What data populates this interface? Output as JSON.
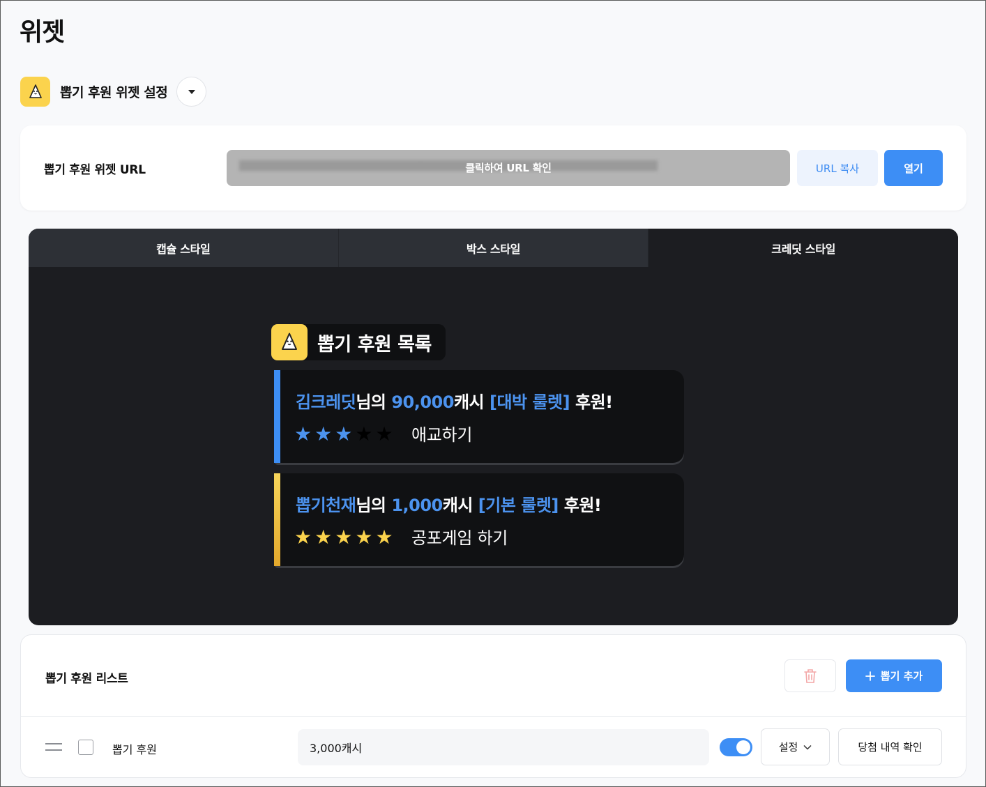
{
  "page": {
    "title": "위젯"
  },
  "selector": {
    "label": "뽑기 후원 위젯 설정",
    "icon": "mascot-icon",
    "dropdown_icon": "caret-down-icon"
  },
  "url_card": {
    "label": "뽑기 후원 위젯 URL",
    "url_overlay_text": "클릭하여 URL 확인",
    "copy_label": "URL 복사",
    "open_label": "열기"
  },
  "preview": {
    "tabs": [
      {
        "label": "캡슐 스타일",
        "active": false
      },
      {
        "label": "박스 스타일",
        "active": false
      },
      {
        "label": "크레딧 스타일",
        "active": true
      }
    ],
    "widget": {
      "title": "뽑기 후원 목록",
      "entries": [
        {
          "name": "김크레딧",
          "suffix1": "님의 ",
          "amount": "90,000",
          "suffix2": "캐시 ",
          "prize": "[대박 룰렛]",
          "suffix3": " 후원!",
          "stars_filled": 3,
          "stars_total": 5,
          "description": "애교하기",
          "bar_color": "#3d8ef5",
          "star_color": "#4c93ef"
        },
        {
          "name": "뽑기천재",
          "suffix1": "님의 ",
          "amount": "1,000",
          "suffix2": "캐시 ",
          "prize": "[기본 룰렛]",
          "suffix3": " 후원!",
          "stars_filled": 5,
          "stars_total": 5,
          "description": "공포게임 하기",
          "bar_color": "#f5c842",
          "star_color": "#fbd34d"
        }
      ]
    }
  },
  "list_card": {
    "title": "뽑기 후원 리스트",
    "add_label": "뽑기 추가",
    "rows": [
      {
        "name": "뽑기 후원",
        "amount": "3,000캐시",
        "enabled": true,
        "settings_label": "설정",
        "history_label": "당첨 내역 확인"
      }
    ]
  },
  "colors": {
    "accent": "#3d8ef5",
    "brand_yellow": "#fbd34d",
    "preview_bg": "#1c1d21"
  }
}
